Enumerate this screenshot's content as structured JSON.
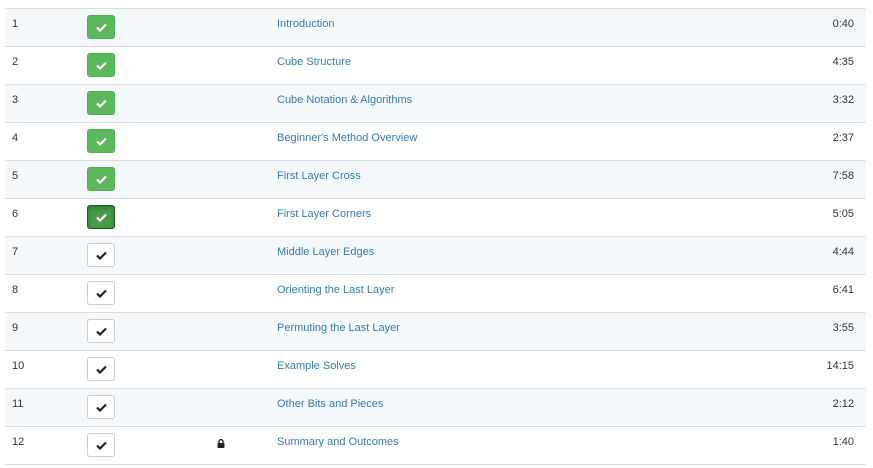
{
  "lessons": [
    {
      "number": "1",
      "title": "Introduction",
      "duration": "0:40",
      "status": "done",
      "locked": false
    },
    {
      "number": "2",
      "title": "Cube Structure",
      "duration": "4:35",
      "status": "done",
      "locked": false
    },
    {
      "number": "3",
      "title": "Cube Notation & Algorithms",
      "duration": "3:32",
      "status": "done",
      "locked": false
    },
    {
      "number": "4",
      "title": "Beginner's Method Overview",
      "duration": "2:37",
      "status": "done",
      "locked": false
    },
    {
      "number": "5",
      "title": "First Layer Cross",
      "duration": "7:58",
      "status": "done",
      "locked": false
    },
    {
      "number": "6",
      "title": "First Layer Corners",
      "duration": "5:05",
      "status": "active",
      "locked": false
    },
    {
      "number": "7",
      "title": "Middle Layer Edges",
      "duration": "4:44",
      "status": "pending",
      "locked": false
    },
    {
      "number": "8",
      "title": "Orienting the Last Layer",
      "duration": "6:41",
      "status": "pending",
      "locked": false
    },
    {
      "number": "9",
      "title": "Permuting the Last Layer",
      "duration": "3:55",
      "status": "pending",
      "locked": false
    },
    {
      "number": "10",
      "title": "Example Solves",
      "duration": "14:15",
      "status": "pending",
      "locked": false
    },
    {
      "number": "11",
      "title": "Other Bits and Pieces",
      "duration": "2:12",
      "status": "pending",
      "locked": false
    },
    {
      "number": "12",
      "title": "Summary and Outcomes",
      "duration": "1:40",
      "status": "pending",
      "locked": true
    }
  ],
  "colors": {
    "done": "#5cb85c",
    "active": "#449d44",
    "link": "#337ab7",
    "row_alt": "#f5f8fb"
  },
  "icons": {
    "check": "check-icon",
    "lock": "lock-icon"
  }
}
